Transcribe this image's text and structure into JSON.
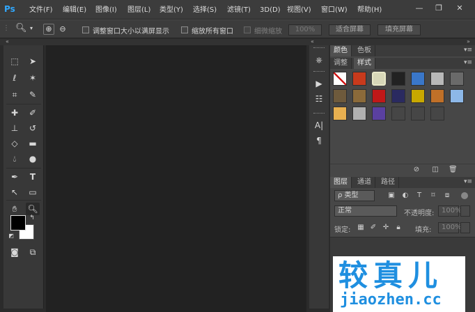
{
  "app": {
    "logo": "Ps"
  },
  "menu": [
    {
      "label": "文件(F)",
      "x": 0
    },
    {
      "label": "编辑(E)"
    },
    {
      "label": "图像(I)"
    },
    {
      "label": "图层(L)"
    },
    {
      "label": "类型(Y)"
    },
    {
      "label": "选择(S)"
    },
    {
      "label": "滤镜(T)"
    },
    {
      "label": "3D(D)"
    },
    {
      "label": "视图(V)"
    },
    {
      "label": "窗口(W)"
    },
    {
      "label": "帮助(H)"
    }
  ],
  "window_controls": {
    "minimize": "—",
    "restore": "❐",
    "close": "✕"
  },
  "options": {
    "resize_windows": "调整窗口大小以满屏显示",
    "zoom_all": "缩放所有窗口",
    "scrubby": "细微缩放",
    "zoom_value": "100%",
    "fit_screen": "适合屏幕",
    "fill_screen": "填充屏幕"
  },
  "panels": {
    "color_tabs": [
      "颜色",
      "色板"
    ],
    "adjust_tabs": [
      "调整",
      "样式"
    ],
    "layers_tabs": [
      "图层",
      "通道",
      "路径"
    ],
    "layers": {
      "kind": "ρ 类型",
      "blend": "正常",
      "opacity_label": "不透明度:",
      "opacity_value": "100%",
      "lock_label": "锁定:",
      "fill_label": "填充:",
      "fill_value": "100%"
    }
  },
  "styles_swatches": [
    "#ffffff",
    "#c83a1c",
    "#d7d7b8",
    "#222222",
    "#3a77c9",
    "#b8b8b8",
    "#6a6a6a",
    "#6e5a3c",
    "#8b6a3a",
    "#c01818",
    "#2a2a60",
    "#c8a800",
    "#c07028",
    "#8db8e8",
    "#e8b050",
    "#b0b0b0",
    "#5a40a0",
    "#464646",
    "#464646",
    "#464646"
  ],
  "watermark": {
    "title": "较真儿",
    "subtitle": "jiaozhen.cc"
  }
}
